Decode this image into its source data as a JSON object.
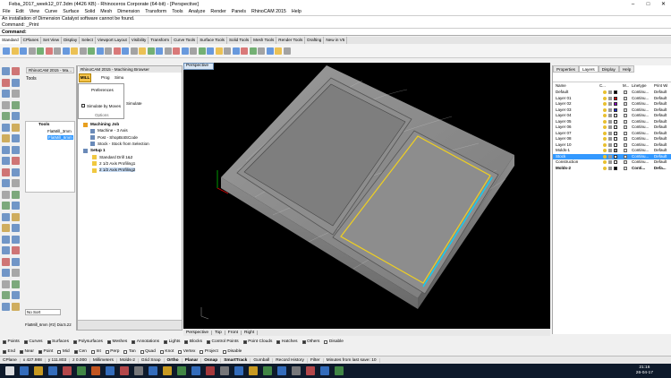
{
  "window": {
    "title": "Feba_2017_week12_07.3dm (4426 KB) - Rhinoceros Corporate (64-bit) - [Perspective]"
  },
  "menu": [
    "File",
    "Edit",
    "View",
    "Curve",
    "Surface",
    "Solid",
    "Mesh",
    "Dimension",
    "Transform",
    "Tools",
    "Analyze",
    "Render",
    "Panels",
    "RhinoCAM 2015",
    "Help"
  ],
  "command": {
    "line1": "An installation of Dimension Catalyst software cannot be found.",
    "line2": "Command: _Print",
    "prompt": "Command:"
  },
  "toolbar_tabs": [
    "Standard",
    "CPlanes",
    "Set View",
    "Display",
    "Select",
    "Viewport Layout",
    "Visibility",
    "Transform",
    "Curve Tools",
    "Surface Tools",
    "Solid Tools",
    "Mesh Tools",
    "Render Tools",
    "Drafting",
    "New in V5"
  ],
  "left_panel": {
    "tab_tools": "Tools",
    "tab_display": "Display",
    "tools_label": "Tools",
    "tool1": "FlatMill_3mm",
    "tool2": "FlatMill_6mm",
    "sort_label": "No Sort",
    "status": "FlatMill_6mm (#2) Dia:5.22"
  },
  "browser": {
    "title": "RhinoCAM 2015 - Machining Browser",
    "mill": "MILL",
    "prog": "Prog",
    "simu": "Simu",
    "preferences": "Preferences",
    "simulate_by_moves": "Simulate by Moves",
    "options": "Options",
    "simulate": "Simulate",
    "tree": [
      "Machining Job",
      "Machine - 3 Axis",
      "Post - ShopBotSCode",
      "Stock - Stock from Selection",
      "Setup 1",
      "Standard Drill 1&2",
      "2 1/2 Axis Profiling1",
      "2 1/2 Axis Profiling2"
    ]
  },
  "viewport": {
    "label": "Perspective",
    "tabs": [
      "Perspective",
      "Top",
      "Front",
      "Right"
    ]
  },
  "layers": {
    "tabs": [
      "Properties",
      "Layers",
      "Display",
      "Help"
    ],
    "headers": [
      "Name",
      "C...",
      "M...",
      "Linetype",
      "Print Wi"
    ],
    "rows": [
      {
        "name": "Default",
        "color": "#000000",
        "lt": "Continu...",
        "pw": "Default"
      },
      {
        "name": "Layer 01",
        "color": "#d40000",
        "lt": "Continu...",
        "pw": "Default"
      },
      {
        "name": "Layer 02",
        "color": "#8a00c8",
        "lt": "Continu...",
        "pw": "Default"
      },
      {
        "name": "Layer 03",
        "color": "#1a2dd4",
        "lt": "Continu...",
        "pw": "Default"
      },
      {
        "name": "Layer 04",
        "color": "#ffffff",
        "lt": "Continu...",
        "pw": "Default"
      },
      {
        "name": "Layer 05",
        "color": "#ffffff",
        "lt": "Continu...",
        "pw": "Default"
      },
      {
        "name": "Layer 06",
        "color": "#ffffff",
        "lt": "Continu...",
        "pw": "Default"
      },
      {
        "name": "Layer 07",
        "color": "#ffffff",
        "lt": "Continu...",
        "pw": "Default"
      },
      {
        "name": "Layer 08",
        "color": "#ffffff",
        "lt": "Continu...",
        "pw": "Default"
      },
      {
        "name": "Layer 10",
        "color": "#ffffff",
        "lt": "Continu...",
        "pw": "Default"
      },
      {
        "name": "Molds-1",
        "color": "#a0a0a0",
        "lt": "Continu...",
        "pw": "Default"
      },
      {
        "name": "Stock",
        "color": "#ffffff",
        "lt": "Continu...",
        "pw": "Default"
      },
      {
        "name": "Construction",
        "color": "#ffffff",
        "lt": "Continu...",
        "pw": "Default"
      },
      {
        "name": "Molds-2",
        "color": "#000000",
        "lt": "Conti...",
        "pw": "Defa..."
      }
    ]
  },
  "osnap_row": [
    "Points",
    "Curves",
    "Surfaces",
    "Polysurfaces",
    "Meshes",
    "Annotations",
    "Lights",
    "Blocks",
    "Control Points",
    "Point Clouds",
    "Hatches",
    "Others",
    "Disable"
  ],
  "osnap_row2": [
    "End",
    "Near",
    "Point",
    "Mid",
    "Cen",
    "Int",
    "Perp",
    "Tan",
    "Quad",
    "Knot",
    "Vertex",
    "Project",
    "Disable"
  ],
  "status": [
    "CPlane",
    "x 427.988",
    "y 111.803",
    "z 0.000",
    "Millimeters",
    "Molds-2",
    "Grid Snap",
    "Ortho",
    "Planar",
    "Osnap",
    "SmartTrack",
    "Gumball",
    "Record History",
    "Filter",
    "Minutes from last save: 10"
  ],
  "clock": {
    "time": "21:16",
    "date": "26-04-17"
  },
  "colors": {
    "selected_row": "#3399ff",
    "viewport_bg": "#000000",
    "toolpath_yellow": "#f0d020",
    "toolpath_cyan": "#00d8ff"
  }
}
